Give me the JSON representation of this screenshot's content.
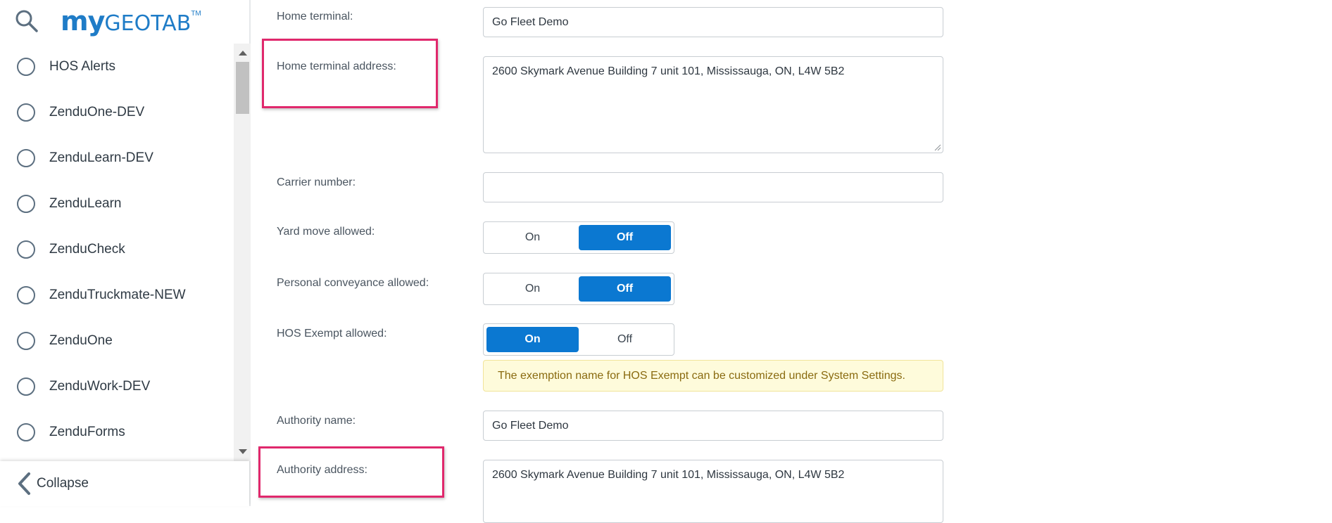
{
  "app": {
    "logo_my": "my",
    "logo_geotab": "GEOTAB",
    "logo_tm": "TM"
  },
  "sidebar": {
    "items": [
      {
        "label": "HOS Alerts"
      },
      {
        "label": "ZenduOne-DEV"
      },
      {
        "label": "ZenduLearn-DEV"
      },
      {
        "label": "ZenduLearn"
      },
      {
        "label": "ZenduCheck"
      },
      {
        "label": "ZenduTruckmate-NEW"
      },
      {
        "label": "ZenduOne"
      },
      {
        "label": "ZenduWork-DEV"
      },
      {
        "label": "ZenduForms"
      }
    ],
    "collapse_label": "Collapse"
  },
  "form": {
    "home_terminal": {
      "label": "Home terminal:",
      "value": "Go Fleet Demo"
    },
    "home_terminal_address": {
      "label": "Home terminal address:",
      "value": "2600 Skymark Avenue Building 7 unit 101, Mississauga, ON,  L4W 5B2"
    },
    "carrier_number": {
      "label": "Carrier number:",
      "value": ""
    },
    "yard_move": {
      "label": "Yard move allowed:",
      "on": "On",
      "off": "Off",
      "selected": "Off"
    },
    "personal_conveyance": {
      "label": "Personal conveyance allowed:",
      "on": "On",
      "off": "Off",
      "selected": "Off"
    },
    "hos_exempt": {
      "label": "HOS Exempt allowed:",
      "on": "On",
      "off": "Off",
      "selected": "On"
    },
    "hos_exempt_note": "The exemption name for HOS Exempt can be customized under System Settings.",
    "authority_name": {
      "label": "Authority name:",
      "value": "Go Fleet Demo"
    },
    "authority_address": {
      "label": "Authority address:",
      "value": "2600 Skymark Avenue Building 7 unit 101, Mississauga, ON,  L4W 5B2"
    }
  },
  "colors": {
    "accent": "#0b78d1",
    "highlight": "#e0286c",
    "note_bg": "#fefbdb",
    "note_text": "#8a6b10"
  },
  "icons": {
    "search": "search-icon",
    "collapse": "chevron-left-icon",
    "nav_item": "radio-circle-icon"
  }
}
